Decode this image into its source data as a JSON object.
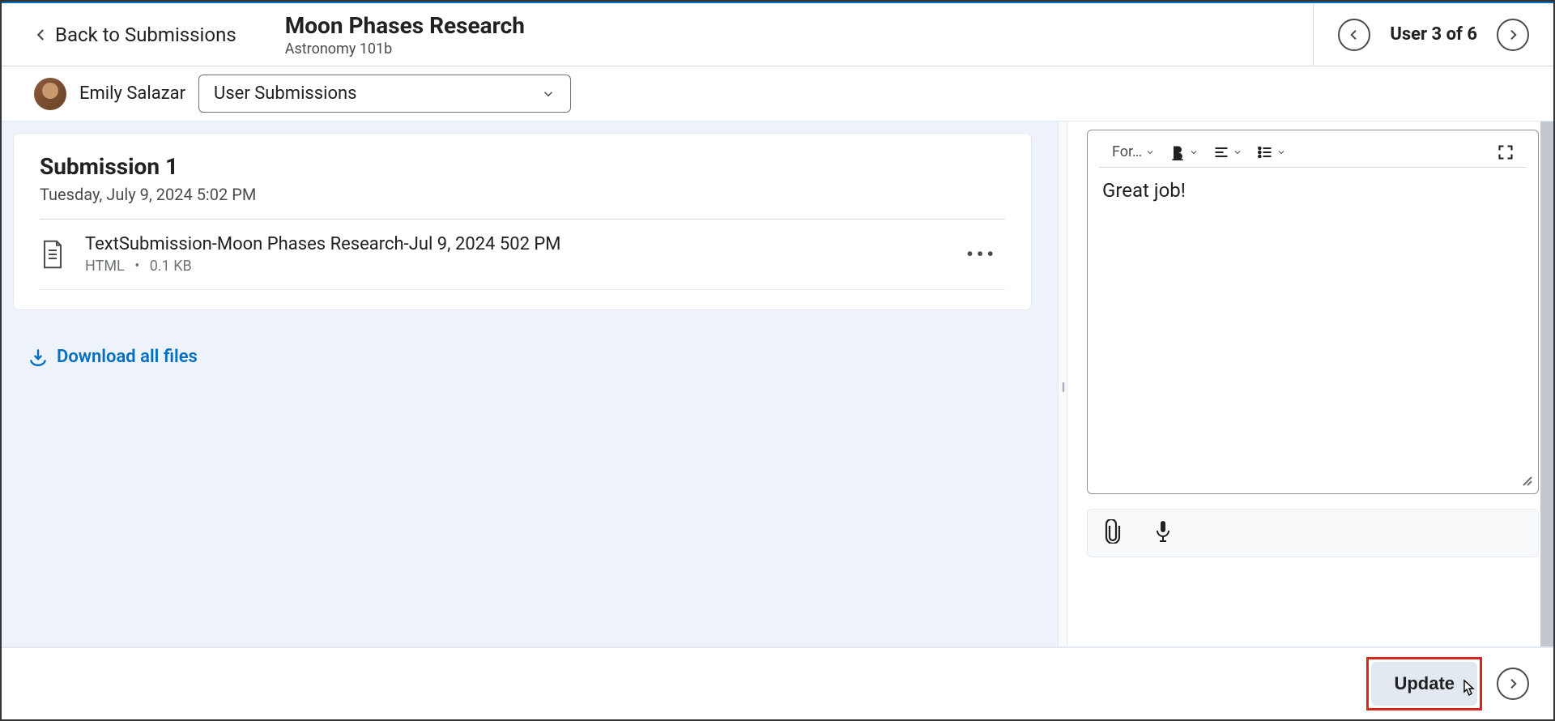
{
  "header": {
    "back_label": "Back to Submissions",
    "assignment_title": "Moon Phases Research",
    "course_title": "Astronomy 101b",
    "user_count_label": "User 3 of 6"
  },
  "subheader": {
    "student_name": "Emily Salazar",
    "dropdown_label": "User Submissions"
  },
  "submission": {
    "title": "Submission 1",
    "date": "Tuesday, July 9, 2024 5:02 PM",
    "file": {
      "name": "TextSubmission-Moon Phases Research-Jul 9, 2024 502 PM",
      "type": "HTML",
      "size": "0.1 KB"
    },
    "download_all_label": "Download all files"
  },
  "feedback": {
    "format_label": "For…",
    "content": "Great job!"
  },
  "footer": {
    "update_label": "Update"
  }
}
